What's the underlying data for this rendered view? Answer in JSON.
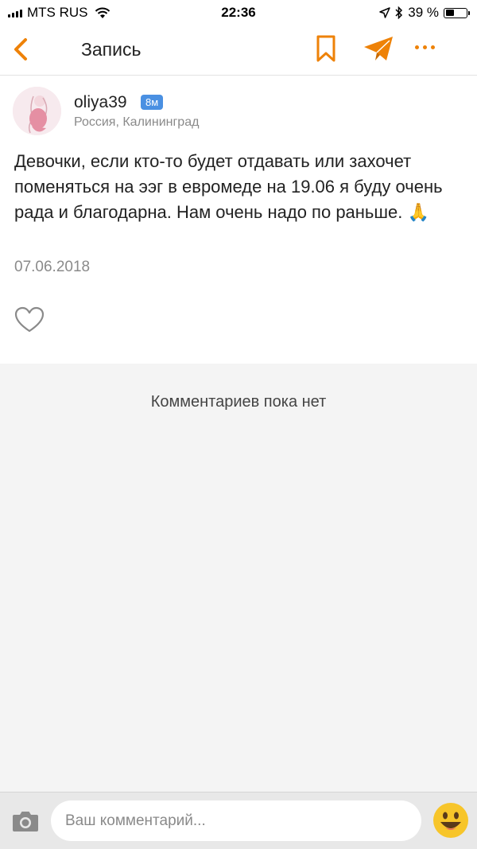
{
  "status_bar": {
    "carrier": "MTS RUS",
    "time": "22:36",
    "battery": "39 %"
  },
  "nav": {
    "title": "Запись"
  },
  "post": {
    "author": "oliya39",
    "badge": "8м",
    "location": "Россия, Калининград",
    "text": "Девочки, если кто-то будет отдавать или захочет поменяться на ээг в евромеде на 19.06 я буду очень рада и благодарна. Нам очень надо по раньше. 🙏",
    "date": "07.06.2018"
  },
  "comments": {
    "empty_text": "Комментариев пока нет"
  },
  "composer": {
    "placeholder": "Ваш комментарий..."
  },
  "colors": {
    "accent": "#ee8208",
    "badge": "#4a90e2"
  }
}
